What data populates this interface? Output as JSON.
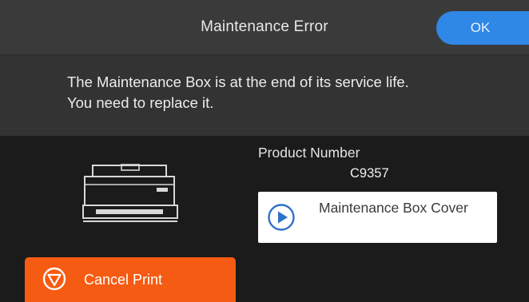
{
  "dialog": {
    "title": "Maintenance Error",
    "ok_label": "OK"
  },
  "message": {
    "line1": "The Maintenance Box is at the end of its service life.",
    "line2": "You need to replace it."
  },
  "product": {
    "label": "Product Number",
    "number": "C9357"
  },
  "cover_button": {
    "label": "Maintenance Box Cover",
    "icon": "play-circle-icon"
  },
  "cancel_button": {
    "label": "Cancel Print",
    "icon": "stop-triangle-icon"
  },
  "printer_image": {
    "icon": "printer-icon"
  },
  "colors": {
    "ok_accent": "#2f87e6",
    "cancel_accent": "#f55b12",
    "play_icon": "#2f72c8"
  }
}
